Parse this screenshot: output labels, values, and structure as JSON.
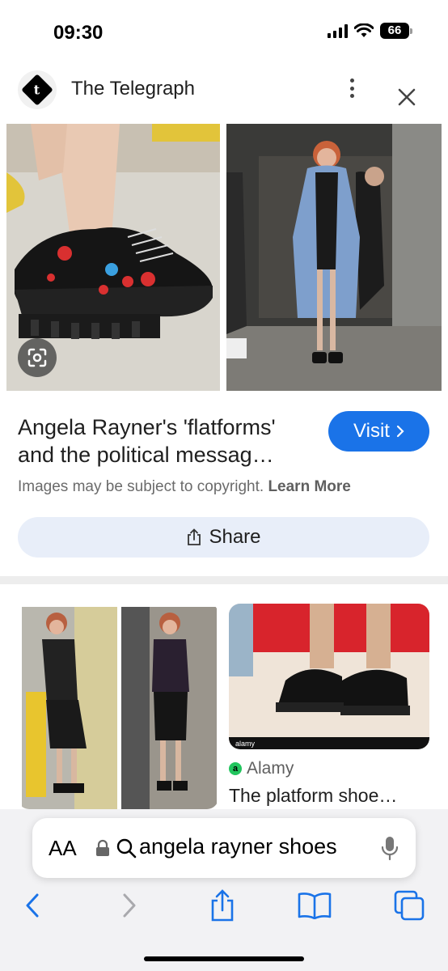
{
  "status_bar": {
    "time": "09:30",
    "battery": "66",
    "icons": [
      "signal-icon",
      "wifi-icon",
      "battery-icon"
    ]
  },
  "header": {
    "source_name": "The Telegraph",
    "logo_letter": "t",
    "icons": [
      "telegraph-logo",
      "more-vert-icon",
      "close-icon"
    ]
  },
  "result": {
    "title": "Angela Rayner's 'flatforms' and the political messag…",
    "visit_label": "Visit",
    "copyright_text": "Images may be subject to copyright.",
    "learn_more": "Learn More",
    "share_label": "Share"
  },
  "related": {
    "source": "Alamy",
    "source_letter": "a",
    "title": "The platform shoe…",
    "watermark": "alamy"
  },
  "browser": {
    "aa_label": "AA",
    "url": "angela rayner shoes"
  },
  "colors": {
    "accent": "#1a73e8",
    "share_bg": "#e8eef9",
    "alamy_green": "#22c55e"
  }
}
